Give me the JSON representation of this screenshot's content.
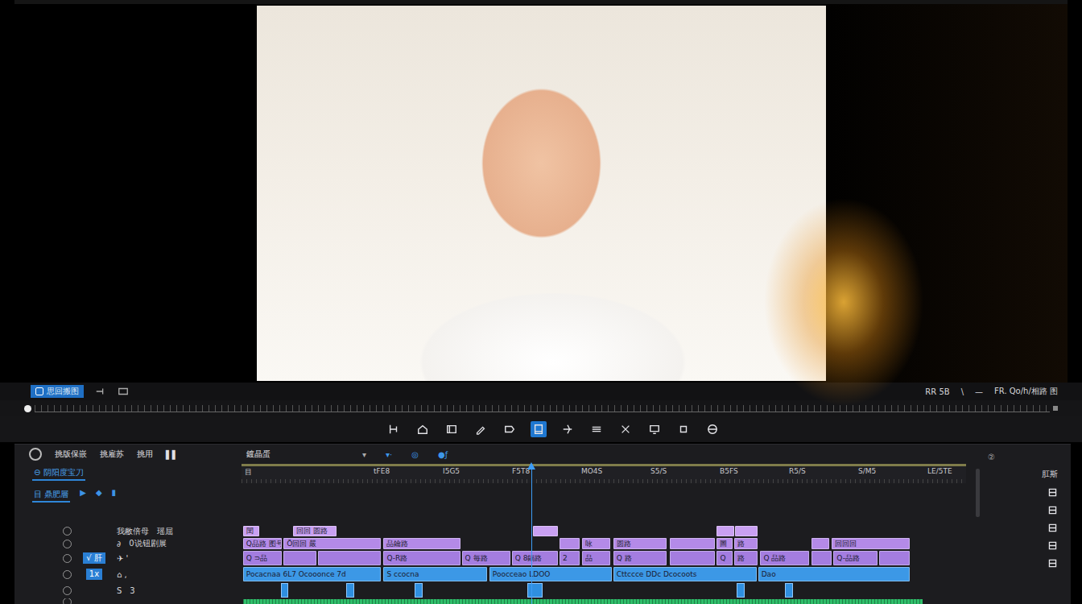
{
  "toolbar": {
    "tab": {
      "label": "思回搬图",
      "selected": true
    },
    "readouts": [
      "RR 5B",
      "\\",
      "—",
      "FR. Qo/h/相路 图"
    ]
  },
  "tools": [
    {
      "selected": false
    },
    {
      "selected": false
    },
    {
      "selected": false
    },
    {
      "selected": false
    },
    {
      "selected": false
    },
    {
      "selected": true
    },
    {
      "selected": false
    },
    {
      "selected": false
    },
    {
      "selected": false
    },
    {
      "selected": false
    },
    {
      "selected": false
    },
    {
      "selected": false
    }
  ],
  "timeline": {
    "panel_tabs": [
      "挑版保嵌",
      "挑雇苏",
      "挑用",
      "▌▌"
    ],
    "sequence": {
      "name": "鍍晶蛋",
      "caret": "▾"
    },
    "controls": [
      "▾·",
      "◎",
      "●ƒ"
    ],
    "bins": [
      {
        "label": "⊖ 阴阳度宝刀",
        "selected": true
      },
      {
        "label": "目 鼎肥層",
        "selected": true
      }
    ],
    "bin_marks": [
      "▶",
      "◆",
      "▮"
    ],
    "ruler_labels": [
      "目",
      "tFE8",
      "I5G5",
      "F5T8",
      "MO4S",
      "S5/S",
      "B5FS",
      "R5/S",
      "S/M5",
      "LE/5TE"
    ],
    "playhead": 0.4,
    "tracks": [
      {
        "kind": "clips",
        "color": "#c9a0f2",
        "header": {
          "texts": [
            "我敝倍母",
            "瑶屈"
          ],
          "tag": ""
        },
        "clips": [
          {
            "label": "閏",
            "start": 0.2,
            "end": 2.4
          },
          {
            "label": "回回 圆路",
            "start": 7.1,
            "end": 13.1
          },
          {
            "label": "",
            "start": 40.2,
            "end": 43.7
          },
          {
            "label": "",
            "start": 65.6,
            "end": 68.0
          },
          {
            "label": "",
            "start": 68.1,
            "end": 71.2
          }
        ]
      },
      {
        "kind": "clips",
        "color": "#b48ae8",
        "header": {
          "texts": [
            "∂",
            "0说钮剧展"
          ],
          "tag": ""
        },
        "clips": [
          {
            "label": "Q品路 图号",
            "start": 0.2,
            "end": 5.6
          },
          {
            "label": "Ŏ回回 嚴",
            "start": 5.8,
            "end": 19.2
          },
          {
            "label": "品鑰路",
            "start": 19.6,
            "end": 30.2
          },
          {
            "label": "",
            "start": 43.9,
            "end": 46.7
          },
          {
            "label": "咏",
            "start": 47.0,
            "end": 50.9
          },
          {
            "label": "圆路",
            "start": 51.3,
            "end": 58.7
          },
          {
            "label": "",
            "start": 59.1,
            "end": 65.3
          },
          {
            "label": "圖",
            "start": 65.6,
            "end": 67.8
          },
          {
            "label": "路",
            "start": 68.0,
            "end": 71.2
          },
          {
            "label": "",
            "start": 78.7,
            "end": 81.1
          },
          {
            "label": "回回回",
            "start": 81.4,
            "end": 92.2
          }
        ]
      },
      {
        "kind": "clips",
        "color": "#a47de0",
        "header": {
          "texts": [
            "✈ '"
          ],
          "tag": "√ 肝"
        },
        "clips": [
          {
            "label": "Q ⊃品",
            "start": 0.2,
            "end": 5.6
          },
          {
            "label": "",
            "start": 5.8,
            "end": 10.3
          },
          {
            "label": "",
            "start": 10.6,
            "end": 19.2
          },
          {
            "label": "Q-R路",
            "start": 19.6,
            "end": 30.2
          },
          {
            "label": "Q 毎路",
            "start": 30.4,
            "end": 37.1
          },
          {
            "label": "Q 8鍋路",
            "start": 37.3,
            "end": 43.7
          },
          {
            "label": "2",
            "start": 43.9,
            "end": 46.7
          },
          {
            "label": "品",
            "start": 47.0,
            "end": 50.9
          },
          {
            "label": "Q 路",
            "start": 51.3,
            "end": 58.7
          },
          {
            "label": "",
            "start": 59.1,
            "end": 65.3
          },
          {
            "label": "Q",
            "start": 65.6,
            "end": 67.8
          },
          {
            "label": "路",
            "start": 68.0,
            "end": 71.2
          },
          {
            "label": "Q 品路",
            "start": 71.6,
            "end": 78.3
          },
          {
            "label": "",
            "start": 78.7,
            "end": 81.4
          },
          {
            "label": "Q-品路",
            "start": 81.7,
            "end": 87.8
          },
          {
            "label": "",
            "start": 88.0,
            "end": 92.2
          }
        ]
      },
      {
        "kind": "clips",
        "color": "#3c98e6",
        "header": {
          "texts": [
            "⌂ ,"
          ],
          "tag": "1x"
        },
        "clips": [
          {
            "label": "Pocacnaa 6L7  Ocooonce 7d",
            "start": 0.2,
            "end": 19.2
          },
          {
            "label": "S ccocna",
            "start": 19.6,
            "end": 33.9
          },
          {
            "label": "Poocceao LDOO",
            "start": 34.2,
            "end": 51.1
          },
          {
            "label": "Cttccce DDc Dcocoots",
            "start": 51.3,
            "end": 71.1
          },
          {
            "label": "Dao",
            "start": 71.3,
            "end": 92.2
          }
        ]
      },
      {
        "kind": "markers",
        "color": "#2f8fe0",
        "header": {
          "texts": [
            "S",
            "3"
          ],
          "tag": ""
        },
        "clips": [
          {
            "label": "",
            "start": 5.4,
            "end": 6.4
          },
          {
            "label": "",
            "start": 14.4,
            "end": 15.6
          },
          {
            "label": "",
            "start": 23.9,
            "end": 25.0
          },
          {
            "label": "",
            "start": 39.4,
            "end": 41.6
          },
          {
            "label": "",
            "start": 68.3,
            "end": 69.4
          },
          {
            "label": "",
            "start": 75.0,
            "end": 76.1
          }
        ]
      },
      {
        "kind": "wave",
        "color": "#2fbf6a",
        "header": {
          "texts": [],
          "tag": ""
        },
        "clips": [
          {
            "label": "",
            "start": 0.2,
            "end": 94.0
          }
        ]
      }
    ]
  },
  "side_panel": {
    "badge": "②",
    "title": "肛斯"
  }
}
